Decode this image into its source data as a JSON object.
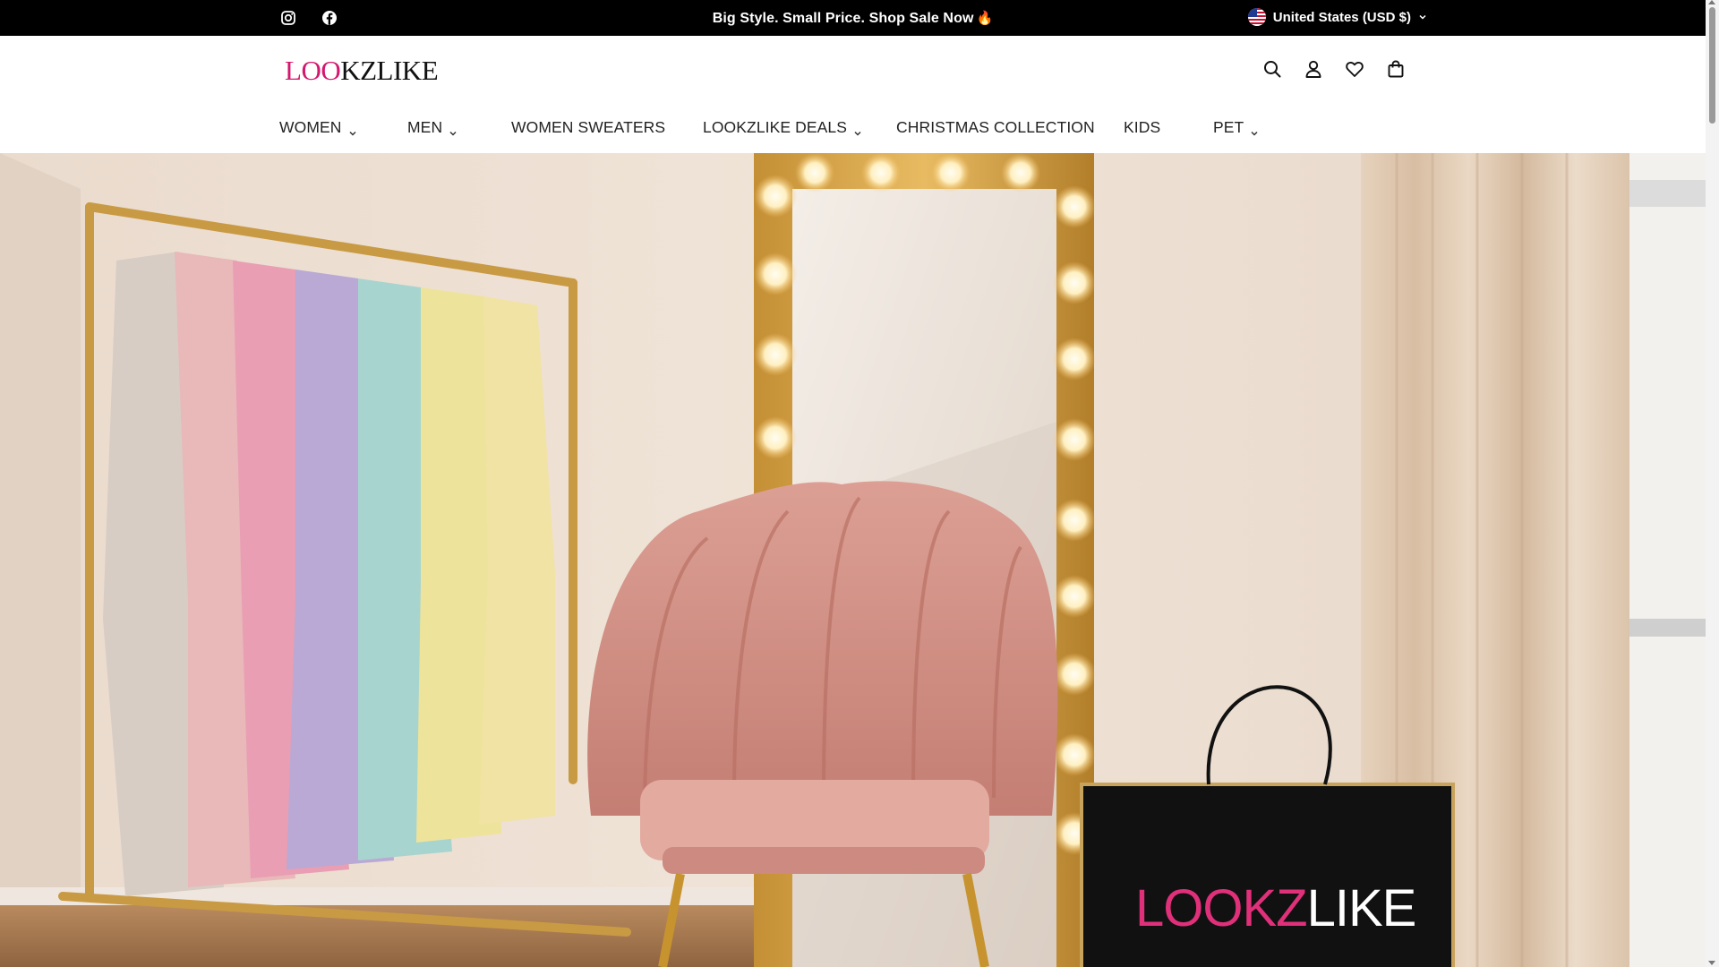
{
  "announcement": {
    "text": "Big Style. Small Price. Shop Sale Now",
    "emoji": "🔥"
  },
  "social": [
    {
      "icon": "instagram-icon"
    },
    {
      "icon": "facebook-icon"
    }
  ],
  "locale": {
    "label": "United States (USD $)",
    "icon": "us-flag-icon"
  },
  "brand": {
    "logo_text_a": "L",
    "logo_text_b": "OO",
    "logo_text_c": "KZLIKE",
    "accent_color": "#d3186e"
  },
  "header_icons": [
    "search-icon",
    "account-icon",
    "wishlist-icon",
    "cart-icon"
  ],
  "nav": {
    "items": [
      {
        "label": "WOMEN",
        "has_dropdown": true
      },
      {
        "label": "MEN",
        "has_dropdown": true
      },
      {
        "label": "WOMEN SWEATERS",
        "has_dropdown": false
      },
      {
        "label": "LOOKZLIKE DEALS",
        "has_dropdown": true
      },
      {
        "label": "CHRISTMAS COLLECTION",
        "has_dropdown": false
      },
      {
        "label": "KIDS",
        "has_dropdown": false
      },
      {
        "label": "PET",
        "has_dropdown": true
      }
    ]
  },
  "hero": {
    "bag_logo_a": "LOOKZ",
    "bag_logo_b": "LIKE"
  }
}
